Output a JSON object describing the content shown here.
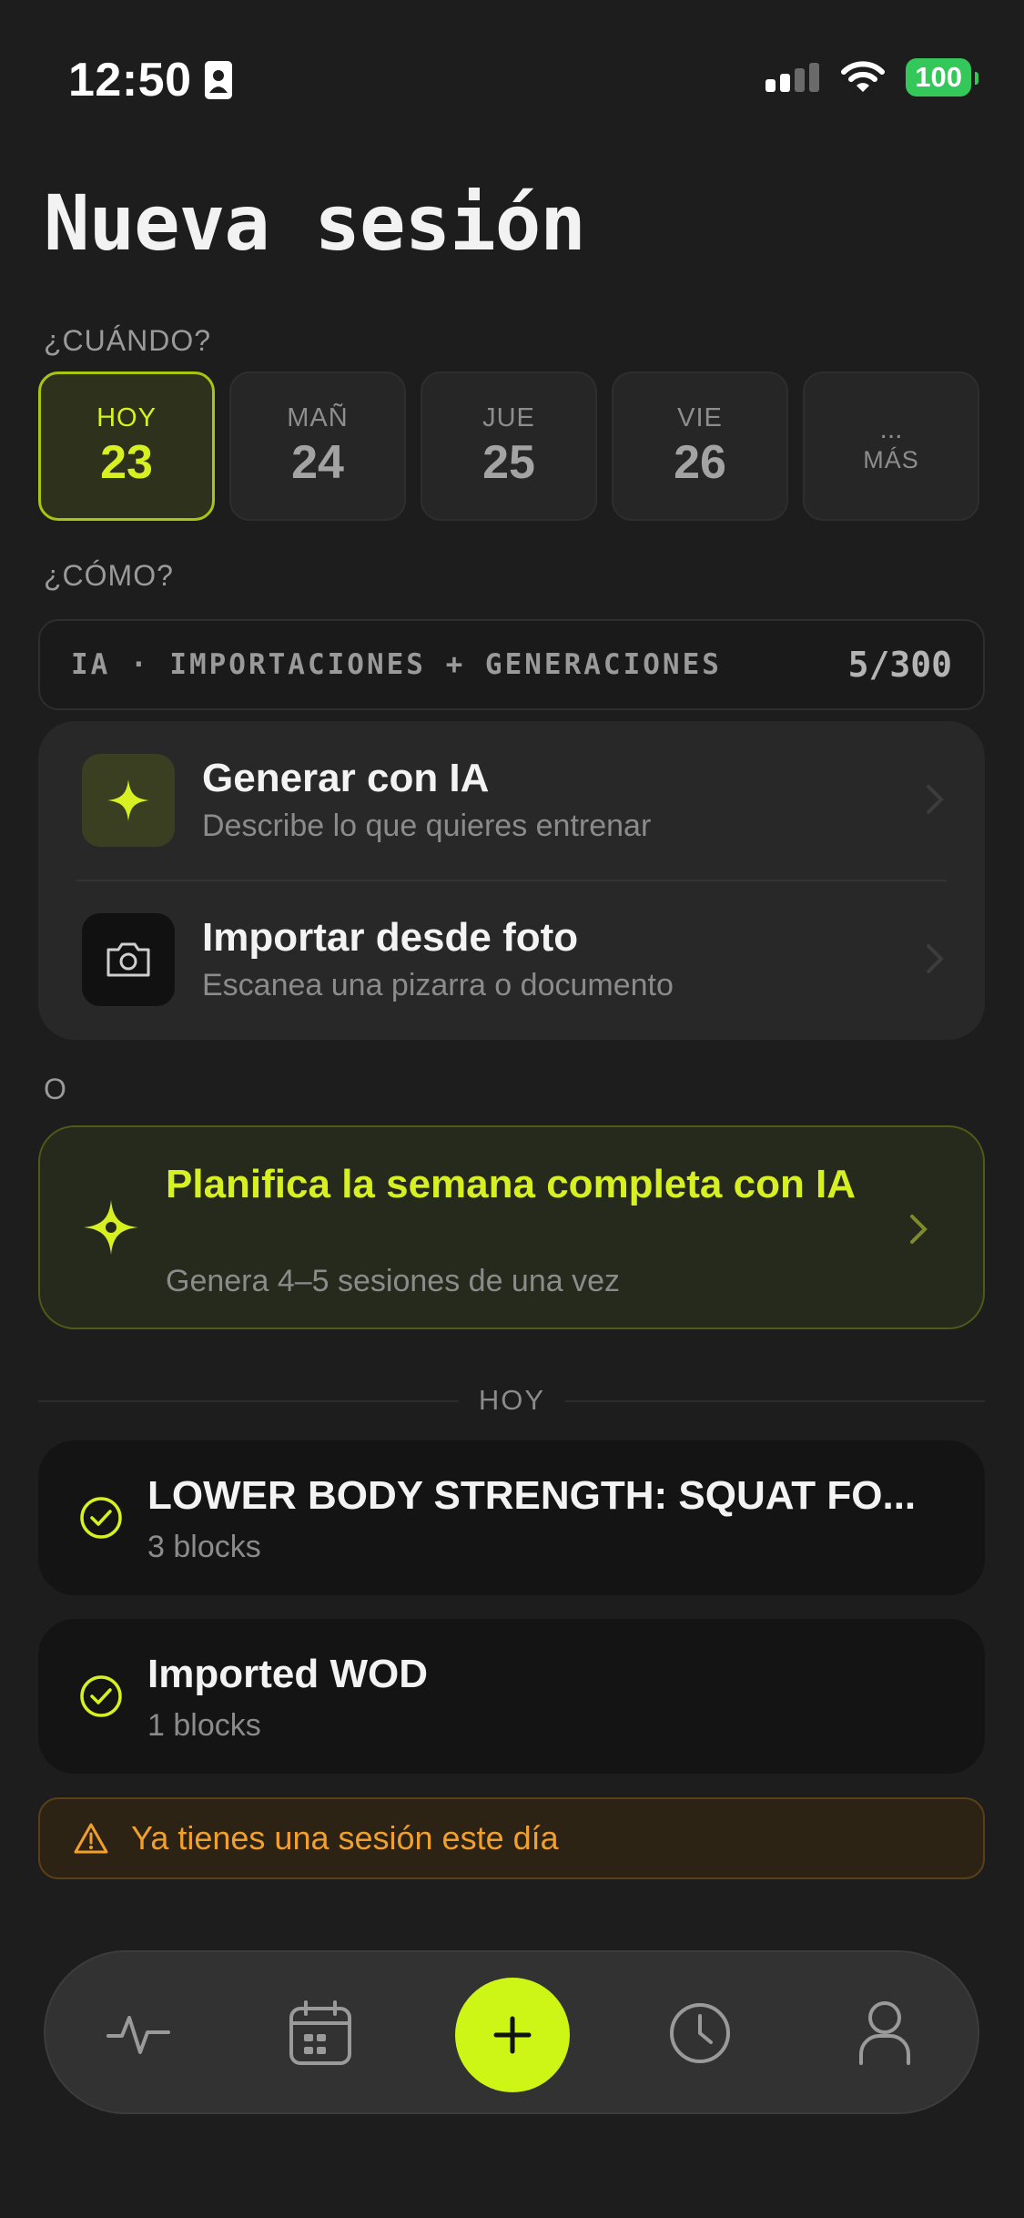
{
  "status_bar": {
    "time": "12:50",
    "battery": "100"
  },
  "page": {
    "title": "Nueva sesión"
  },
  "when": {
    "label": "¿CUÁNDO?",
    "days": [
      {
        "name": "HOY",
        "num": "23",
        "selected": true
      },
      {
        "name": "MAÑ",
        "num": "24",
        "selected": false
      },
      {
        "name": "JUE",
        "num": "25",
        "selected": false
      },
      {
        "name": "VIE",
        "num": "26",
        "selected": false
      }
    ],
    "more": {
      "dots": "...",
      "label": "MÁS"
    }
  },
  "how": {
    "label": "¿CÓMO?",
    "quota_label": "IA · IMPORTACIONES + GENERACIONES",
    "quota_count": "5/300",
    "options": [
      {
        "title": "Generar con IA",
        "subtitle": "Describe lo que quieres entrenar",
        "icon": "sparkle-icon"
      },
      {
        "title": "Importar desde foto",
        "subtitle": "Escanea una pizarra o documento",
        "icon": "camera-icon"
      }
    ]
  },
  "or_label": "O",
  "plan_week": {
    "title": "Planifica la semana completa con IA",
    "subtitle": "Genera 4–5 sesiones de una vez",
    "icon": "sparkles-icon"
  },
  "today": {
    "label": "HOY",
    "sessions": [
      {
        "title": "LOWER BODY STRENGTH: SQUAT FO...",
        "subtitle": "3 blocks"
      },
      {
        "title": "Imported WOD",
        "subtitle": "1 blocks"
      }
    ]
  },
  "warning": {
    "text": "Ya tienes una sesión este día",
    "icon": "warning-icon"
  },
  "tabbar": {
    "tabs": [
      "activity-icon",
      "calendar-icon",
      "plus-icon",
      "clock-icon",
      "profile-icon"
    ]
  },
  "colors": {
    "accent": "#cdf516",
    "background": "#1d1d1d",
    "warning": "#f2a02c",
    "battery": "#34c759"
  }
}
